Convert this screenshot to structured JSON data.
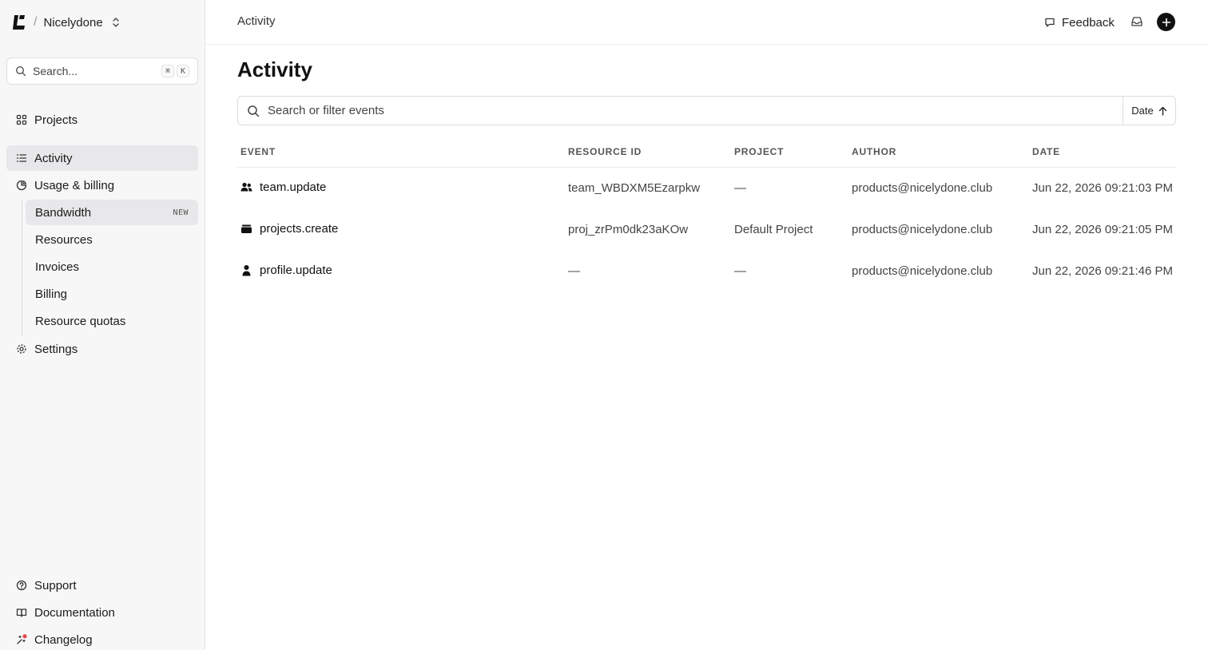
{
  "sidebar": {
    "team_name": "Nicelydone",
    "separator": "/",
    "search": {
      "placeholder": "Search...",
      "shortcut_mod": "⌘",
      "shortcut_key": "K"
    },
    "nav": {
      "projects": "Projects",
      "activity": "Activity",
      "usage_billing": "Usage & billing",
      "settings": "Settings"
    },
    "usage_sub": [
      {
        "label": "Bandwidth",
        "badge": "NEW"
      },
      {
        "label": "Resources"
      },
      {
        "label": "Invoices"
      },
      {
        "label": "Billing"
      },
      {
        "label": "Resource quotas"
      }
    ],
    "footer": {
      "support": "Support",
      "documentation": "Documentation",
      "changelog": "Changelog"
    },
    "changelog_dot_color": "#e5484d"
  },
  "header": {
    "breadcrumb": "Activity",
    "feedback": "Feedback"
  },
  "main": {
    "title": "Activity",
    "filter": {
      "placeholder": "Search or filter events",
      "sort_label": "Date"
    },
    "columns": {
      "event": "EVENT",
      "resource_id": "RESOURCE ID",
      "project": "PROJECT",
      "author": "AUTHOR",
      "date": "DATE"
    },
    "rows": [
      {
        "icon": "users-icon",
        "event": "team.update",
        "resource_id": "team_WBDXM5Ezarpkw",
        "project": "—",
        "author": "products@nicelydone.club",
        "date": "Jun 22, 2026 09:21:03 PM"
      },
      {
        "icon": "folder-icon",
        "event": "projects.create",
        "resource_id": "proj_zrPm0dk23aKOw",
        "project": "Default Project",
        "author": "products@nicelydone.club",
        "date": "Jun 22, 2026 09:21:05 PM"
      },
      {
        "icon": "user-icon",
        "event": "profile.update",
        "resource_id": "—",
        "project": "—",
        "author": "products@nicelydone.club",
        "date": "Jun 22, 2026 09:21:46 PM"
      }
    ]
  }
}
